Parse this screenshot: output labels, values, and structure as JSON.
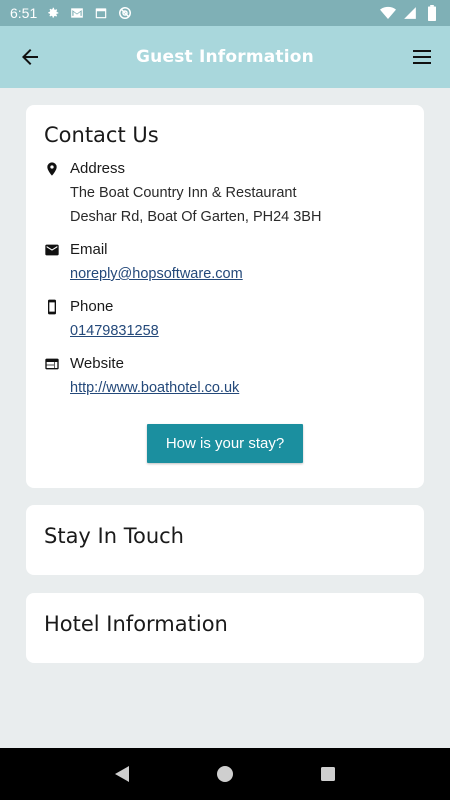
{
  "status_bar": {
    "time": "6:51",
    "left_icons": [
      "gear-icon",
      "gmail-icon",
      "calendar-icon",
      "at-sign-icon"
    ],
    "right_icons": [
      "wifi-icon",
      "signal-icon",
      "battery-icon"
    ],
    "background": "#7fb0b6"
  },
  "app_bar": {
    "title": "Guest Information",
    "background": "#a9d7dc"
  },
  "contact": {
    "title": "Contact Us",
    "address": {
      "label": "Address",
      "line1": "The Boat Country Inn & Restaurant",
      "line2": "Deshar Rd, Boat Of Garten, PH24 3BH"
    },
    "email": {
      "label": "Email",
      "value": "noreply@hopsoftware.com"
    },
    "phone": {
      "label": "Phone",
      "value": "01479831258"
    },
    "website": {
      "label": "Website",
      "value": "http://www.boathotel.co.uk"
    },
    "button_label": "How is your stay?",
    "button_color": "#1b8f9f"
  },
  "stay_in_touch": {
    "title": "Stay In Touch"
  },
  "hotel_info": {
    "title": "Hotel Information"
  },
  "nav_bar": {
    "buttons": [
      "back-triangle-icon",
      "home-circle-icon",
      "recents-square-icon"
    ]
  }
}
